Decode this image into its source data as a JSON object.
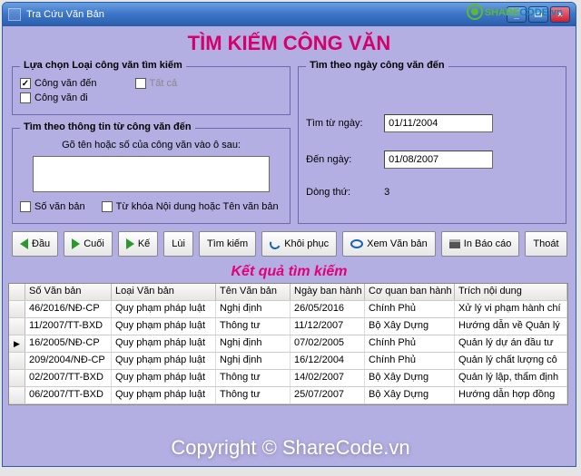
{
  "watermark": {
    "brand1": "SHARE",
    "brand2": "CODE",
    "suffix": ".vn",
    "bottom": "Copyright © ShareCode.vn"
  },
  "window": {
    "title": "Tra Cứu Văn Bản"
  },
  "page_title": "TÌM KIẾM CÔNG VĂN",
  "left_group": {
    "legend": "Lựa chọn Loại công văn tìm kiếm",
    "opt_den": "Công văn đến",
    "opt_di": "Công văn  đi",
    "opt_all": "Tất cả",
    "checked_den": true,
    "checked_di": false
  },
  "info_group": {
    "legend": "Tìm theo thông tin từ công văn đến",
    "hint": "Gõ tên hoặc số của công văn vào ô sau:",
    "value": "",
    "chk_so": "Số văn bản",
    "chk_tu": "Từ khóa Nội dung hoặc Tên văn bản"
  },
  "right_group": {
    "legend": "Tìm theo ngày công văn đến",
    "from_label": "Tìm từ ngày:",
    "from_value": "01/11/2004",
    "to_label": "Đến ngày:",
    "to_value": "01/08/2007",
    "row_label": "Dòng thứ:",
    "row_value": "3"
  },
  "toolbar": {
    "dau": "Đầu",
    "cuoi": "Cuối",
    "ke": "Kế",
    "lui": "Lùi",
    "tim": "Tìm kiếm",
    "khoi": "Khôi phục",
    "xem": "Xem Văn bản",
    "in": "In Báo cáo",
    "thoat": "Thoát"
  },
  "results_title": "Kết quả tìm kiếm",
  "grid": {
    "columns": [
      "Số Văn bản",
      "Loại Văn bản",
      "Tên Văn bản",
      "Ngày ban hành",
      "Cơ quan ban hành",
      "Trích nội dung"
    ],
    "selected_index": 2,
    "rows": [
      {
        "c0": "46/2016/NĐ-CP",
        "c1": "Quy phạm pháp luật",
        "c2": "Nghị định",
        "c3": "26/05/2016",
        "c4": "Chính Phủ",
        "c5": "Xử lý vi phạm hành chí"
      },
      {
        "c0": "11/2007/TT-BXD",
        "c1": "Quy phạm pháp luật",
        "c2": "Thông tư",
        "c3": "11/12/2007",
        "c4": "Bộ Xây Dựng",
        "c5": "Hướng dẫn về Quản lý"
      },
      {
        "c0": "16/2005/NĐ-CP",
        "c1": "Quy phạm pháp luật",
        "c2": "Nghị định",
        "c3": "07/02/2005",
        "c4": "Chính Phủ",
        "c5": "Quản lý dự án đầu tư"
      },
      {
        "c0": "209/2004/NĐ-CP",
        "c1": "Quy phạm pháp luật",
        "c2": "Nghị định",
        "c3": "16/12/2004",
        "c4": "Chính Phủ",
        "c5": "Quản lý chất lượng cô"
      },
      {
        "c0": "02/2007/TT-BXD",
        "c1": "Quy phạm pháp luật",
        "c2": "Thông tư",
        "c3": "14/02/2007",
        "c4": "Bộ Xây Dựng",
        "c5": "Quản lý lập, thẩm định"
      },
      {
        "c0": "06/2007/TT-BXD",
        "c1": "Quy phạm pháp luật",
        "c2": "Thông tư",
        "c3": "25/07/2007",
        "c4": "Bộ Xây Dựng",
        "c5": "Hướng dẫn hợp đồng"
      }
    ]
  },
  "chart_data": null
}
